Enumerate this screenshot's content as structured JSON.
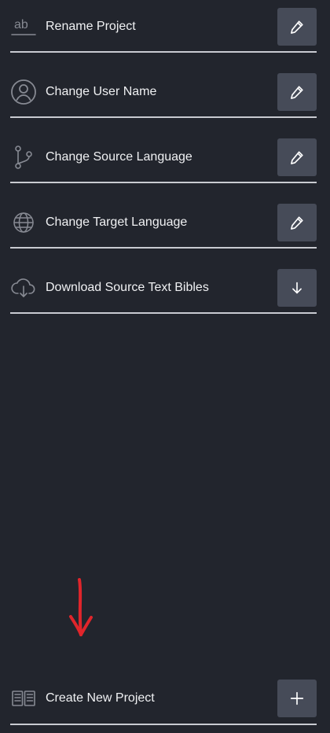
{
  "settings": {
    "items": [
      {
        "id": "rename-project",
        "label": "Rename Project",
        "icon": "text-ab-icon",
        "action_icon": "pencil-icon"
      },
      {
        "id": "change-user-name",
        "label": "Change User Name",
        "icon": "user-circle-icon",
        "action_icon": "pencil-icon"
      },
      {
        "id": "change-source-language",
        "label": "Change Source Language",
        "icon": "git-branch-icon",
        "action_icon": "pencil-icon"
      },
      {
        "id": "change-target-language",
        "label": "Change Target Language",
        "icon": "globe-icon",
        "action_icon": "pencil-icon"
      },
      {
        "id": "download-source-text-bibles",
        "label": "Download Source Text Bibles",
        "icon": "cloud-download-icon",
        "action_icon": "arrow-down-icon"
      }
    ],
    "create_project": {
      "label": "Create New Project",
      "icon": "open-book-icon",
      "action_icon": "plus-icon"
    }
  },
  "annotation": {
    "arrow_icon": "red-down-arrow-icon",
    "color": "#e0252b"
  },
  "colors": {
    "background": "#22252d",
    "button_background": "#464b58",
    "divider": "#c9cbd1",
    "label_text": "#f0f1f3",
    "icon": "#878a93"
  }
}
